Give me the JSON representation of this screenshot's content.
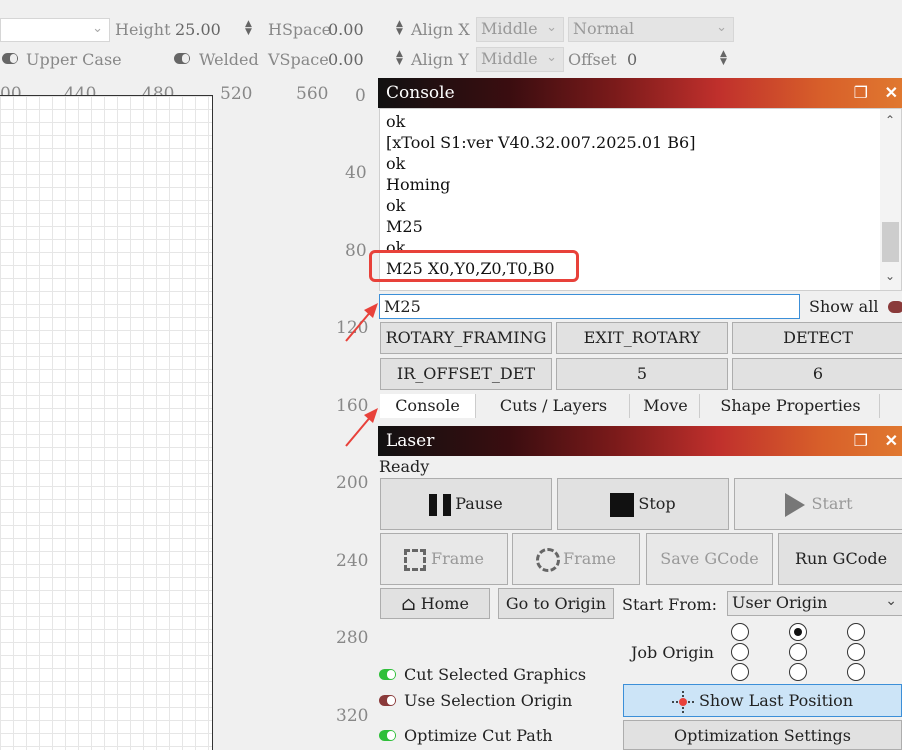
{
  "toolbar": {
    "height_label": "Height",
    "height_value": "25.00",
    "hspace_label": "HSpace",
    "hspace_value": "0.00",
    "vspace_label": "VSpace",
    "vspace_value": "0.00",
    "upper_case": "Upper Case",
    "welded": "Welded",
    "align_x_label": "Align X",
    "align_x_value": "Middle",
    "align_y_label": "Align Y",
    "align_y_value": "Middle",
    "style_value": "Normal",
    "offset_label": "Offset",
    "offset_value": "0"
  },
  "ruler": {
    "top": [
      "00",
      "440",
      "480",
      "520",
      "560"
    ],
    "left": [
      "0",
      "40",
      "80",
      "120",
      "160",
      "200",
      "240",
      "280",
      "320"
    ]
  },
  "console": {
    "title": "Console",
    "lines": [
      "ok",
      "[xTool S1:ver V40.32.007.2025.01 B6]",
      "ok",
      "Homing",
      "ok",
      "M25",
      "ok",
      "M25 X0,Y0,Z0,T0,B0"
    ],
    "input_value": "M25",
    "show_all": "Show all",
    "macros": [
      "ROTARY_FRAMING",
      "EXIT_ROTARY",
      "DETECT",
      "IR_OFFSET_DET",
      "5",
      "6"
    ],
    "tabs": [
      "Console",
      "Cuts / Layers",
      "Move",
      "Shape Properties"
    ]
  },
  "laser": {
    "title": "Laser",
    "status": "Ready",
    "pause": "Pause",
    "stop": "Stop",
    "start": "Start",
    "frame1": "Frame",
    "frame2": "Frame",
    "save_gcode": "Save GCode",
    "run_gcode": "Run GCode",
    "home": "Home",
    "go_to_origin": "Go to Origin",
    "start_from_label": "Start From:",
    "start_from_value": "User Origin",
    "job_origin_label": "Job Origin",
    "cut_selected": "Cut Selected Graphics",
    "use_selection_origin": "Use Selection Origin",
    "optimize_cut_path": "Optimize Cut Path",
    "show_last_position": "Show Last Position",
    "optimization_settings": "Optimization Settings"
  },
  "colors": {
    "accent_red": "#e8413a",
    "toggle_green": "#2fbf3a",
    "toggle_maroon": "#8a3a3a",
    "highlight_button": "#cce4f7"
  }
}
